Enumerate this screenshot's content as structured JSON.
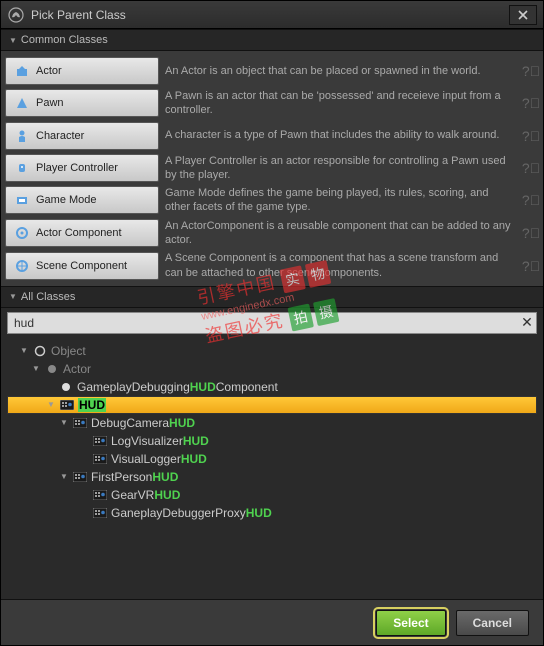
{
  "window": {
    "title": "Pick Parent Class"
  },
  "sections": {
    "common": "Common Classes",
    "all": "All Classes"
  },
  "classes": [
    {
      "label": "Actor",
      "desc": "An Actor is an object that can be placed or spawned in the world."
    },
    {
      "label": "Pawn",
      "desc": "A Pawn is an actor that can be 'possessed' and receieve input from a controller."
    },
    {
      "label": "Character",
      "desc": "A character is a type of Pawn that includes the ability to walk around."
    },
    {
      "label": "Player Controller",
      "desc": "A Player Controller is an actor responsible for controlling a Pawn used by the player."
    },
    {
      "label": "Game Mode",
      "desc": "Game Mode defines the game being played, its rules, scoring, and other facets of the game type."
    },
    {
      "label": "Actor Component",
      "desc": "An ActorComponent is a reusable component that can be added to any actor."
    },
    {
      "label": "Scene Component",
      "desc": "A Scene Component is a component that has a scene transform and can be attached to other scene components."
    }
  ],
  "search": {
    "value": "hud",
    "clear": "✕"
  },
  "tree": {
    "object": "Object",
    "actor": "Actor",
    "items": [
      {
        "pre": "GameplayDebugging",
        "hi": "HUD",
        "post": "Component"
      },
      {
        "pre": "",
        "hi": "HUD",
        "post": ""
      },
      {
        "pre": "DebugCamera",
        "hi": "HUD",
        "post": ""
      },
      {
        "pre": "LogVisualizer",
        "hi": "HUD",
        "post": ""
      },
      {
        "pre": "VisualLogger",
        "hi": "HUD",
        "post": ""
      },
      {
        "pre": "FirstPerson",
        "hi": "HUD",
        "post": ""
      },
      {
        "pre": "GearVR",
        "hi": "HUD",
        "post": ""
      },
      {
        "pre": "GaneplayDebuggerProxy",
        "hi": "HUD",
        "post": ""
      }
    ]
  },
  "buttons": {
    "select": "Select",
    "cancel": "Cancel"
  },
  "watermark": {
    "line1": "引擎中国",
    "badges": [
      "实",
      "物",
      "拍",
      "摄"
    ],
    "url": "www.enginedx.com",
    "line2": "盗图必究"
  }
}
